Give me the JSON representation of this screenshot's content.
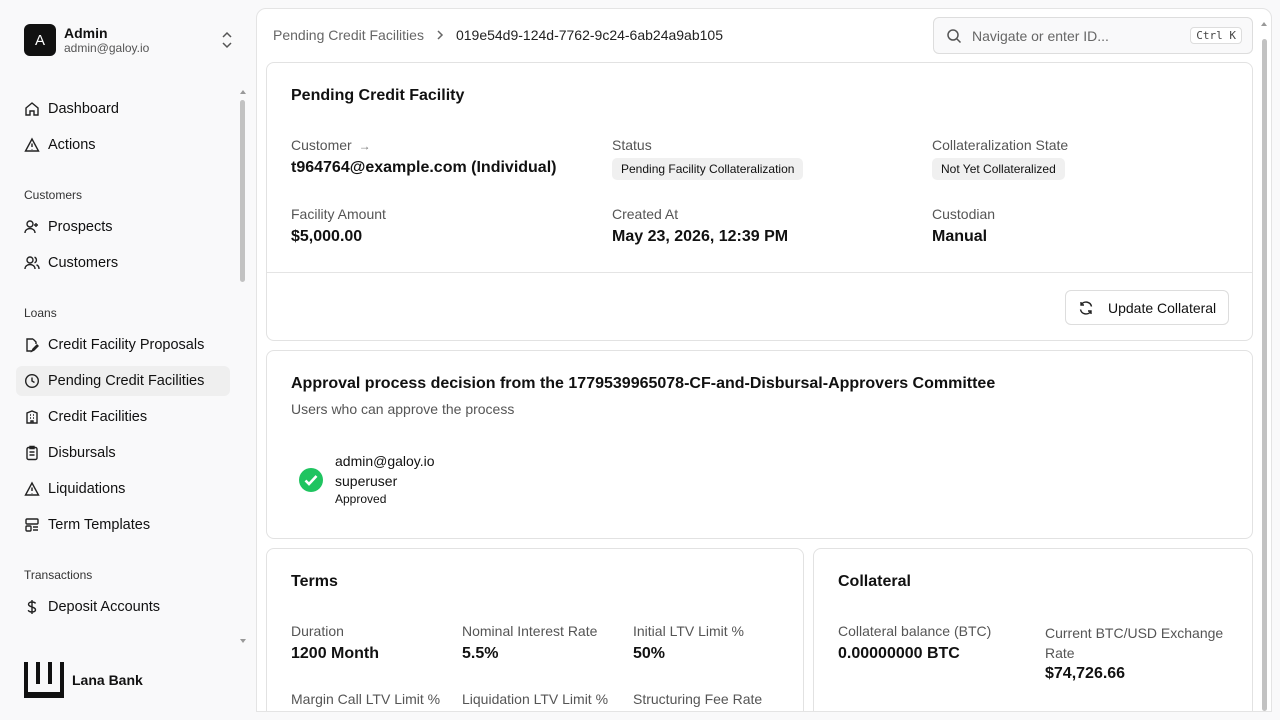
{
  "user": {
    "initial": "A",
    "name": "Admin",
    "email": "admin@galoy.io"
  },
  "nav": {
    "top": [
      {
        "label": "Dashboard",
        "icon": "home-icon"
      },
      {
        "label": "Actions",
        "icon": "alert-triangle-icon"
      }
    ],
    "customers_group": "Customers",
    "customers": [
      {
        "label": "Prospects",
        "icon": "user-plus-icon"
      },
      {
        "label": "Customers",
        "icon": "users-icon"
      }
    ],
    "loans_group": "Loans",
    "loans": [
      {
        "label": "Credit Facility Proposals",
        "icon": "file-edit-icon"
      },
      {
        "label": "Pending Credit Facilities",
        "icon": "clock-icon",
        "active": true
      },
      {
        "label": "Credit Facilities",
        "icon": "building-icon"
      },
      {
        "label": "Disbursals",
        "icon": "clipboard-icon"
      },
      {
        "label": "Liquidations",
        "icon": "alert-triangle-icon"
      },
      {
        "label": "Term Templates",
        "icon": "template-icon"
      }
    ],
    "transactions_group": "Transactions",
    "transactions": [
      {
        "label": "Deposit Accounts",
        "icon": "dollar-icon"
      }
    ]
  },
  "brand": {
    "name": "Lana Bank"
  },
  "breadcrumb": {
    "parent": "Pending Credit Facilities",
    "current": "019e54d9-124d-7762-9c24-6ab24a9ab105"
  },
  "search": {
    "placeholder": "Navigate or enter ID...",
    "shortcut": "Ctrl K"
  },
  "facility": {
    "title": "Pending Credit Facility",
    "customer_label": "Customer",
    "customer_value": "t964764@example.com (Individual)",
    "status_label": "Status",
    "status_value": "Pending Facility Collateralization",
    "collat_state_label": "Collateralization State",
    "collat_state_value": "Not Yet Collateralized",
    "amount_label": "Facility Amount",
    "amount_value": "$5,000.00",
    "created_label": "Created At",
    "created_value": "May 23, 2026, 12:39 PM",
    "custodian_label": "Custodian",
    "custodian_value": "Manual",
    "update_button": "Update Collateral"
  },
  "approval": {
    "title": "Approval process decision from the 1779539965078-CF-and-Disbursal-Approvers Committee",
    "subtitle": "Users who can approve the process",
    "approver_email": "admin@galoy.io",
    "approver_role": "superuser",
    "approver_status": "Approved",
    "status_color": "#1fc460"
  },
  "terms": {
    "title": "Terms",
    "duration_label": "Duration",
    "duration_value": "1200 Month",
    "interest_label": "Nominal Interest Rate",
    "interest_value": "5.5%",
    "initial_ltv_label": "Initial LTV Limit %",
    "initial_ltv_value": "50%",
    "margin_label": "Margin Call LTV Limit %",
    "liquidation_label": "Liquidation LTV Limit %",
    "fee_label": "Structuring Fee Rate"
  },
  "collateral": {
    "title": "Collateral",
    "balance_label": "Collateral balance (BTC)",
    "balance_value": "0.00000000 BTC",
    "rate_label": "Current BTC/USD Exchange Rate",
    "rate_value": "$74,726.66"
  }
}
